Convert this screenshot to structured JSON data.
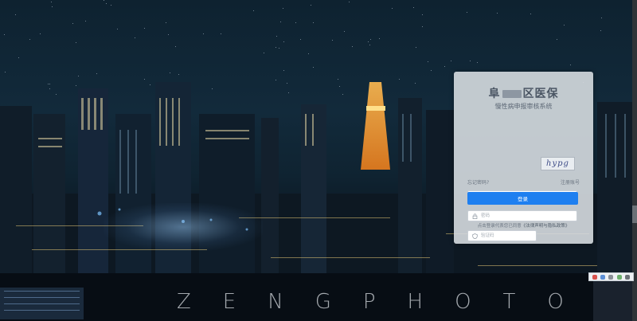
{
  "background": {
    "watermark": "ZENGPHOTO"
  },
  "login": {
    "title_prefix": "阜",
    "title_suffix": "区医保",
    "subtitle": "慢性病申报审核系统",
    "username_placeholder": "请输入手机号",
    "password_placeholder": "密码",
    "captcha_placeholder": "验证码",
    "captcha_text": "hypg",
    "forgot_label": "忘记密码?",
    "register_label": "注册账号",
    "login_button": "登录",
    "agreement_prefix": "点击登录代表您已同意",
    "agreement_link": "《法律声明与隐私政策》"
  },
  "colors": {
    "primary_button": "#1e7ff0",
    "panel_bg": "#d6dbe0"
  }
}
